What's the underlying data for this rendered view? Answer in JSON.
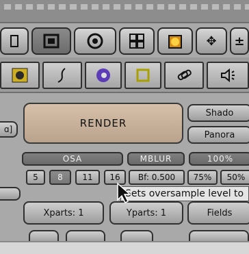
{
  "render": {
    "render_label": "RENDER"
  },
  "right_panel": {
    "shadow_label": "Shado",
    "panorama_label": "Panora",
    "percent_label": "100%",
    "percent75": "75%",
    "percent50": "50%"
  },
  "antialias": {
    "osa_label": "OSA",
    "mblur_label": "MBLUR",
    "levels": [
      "5",
      "8",
      "11",
      "16"
    ],
    "selected_level": "8",
    "bf_value": "Bf: 0.500"
  },
  "parts": {
    "xparts": "Xparts: 1",
    "yparts": "Yparts: 1",
    "fields": "Fields"
  },
  "tooltip": {
    "text": "Sets oversample level to"
  },
  "colors": {
    "panel_bg": "#a9a9a9",
    "render_button": "#c8b29b",
    "selected_dark": "#777777"
  },
  "icons": {
    "toolbar": [
      "window-icon",
      "eye-icon",
      "grid-icon",
      "cube-icon",
      "move-icon",
      "plus-minus-icon"
    ],
    "secondary": [
      "material-icon",
      "curve-icon",
      "world-icon",
      "square-icon",
      "link-icon",
      "sound-icon"
    ]
  }
}
